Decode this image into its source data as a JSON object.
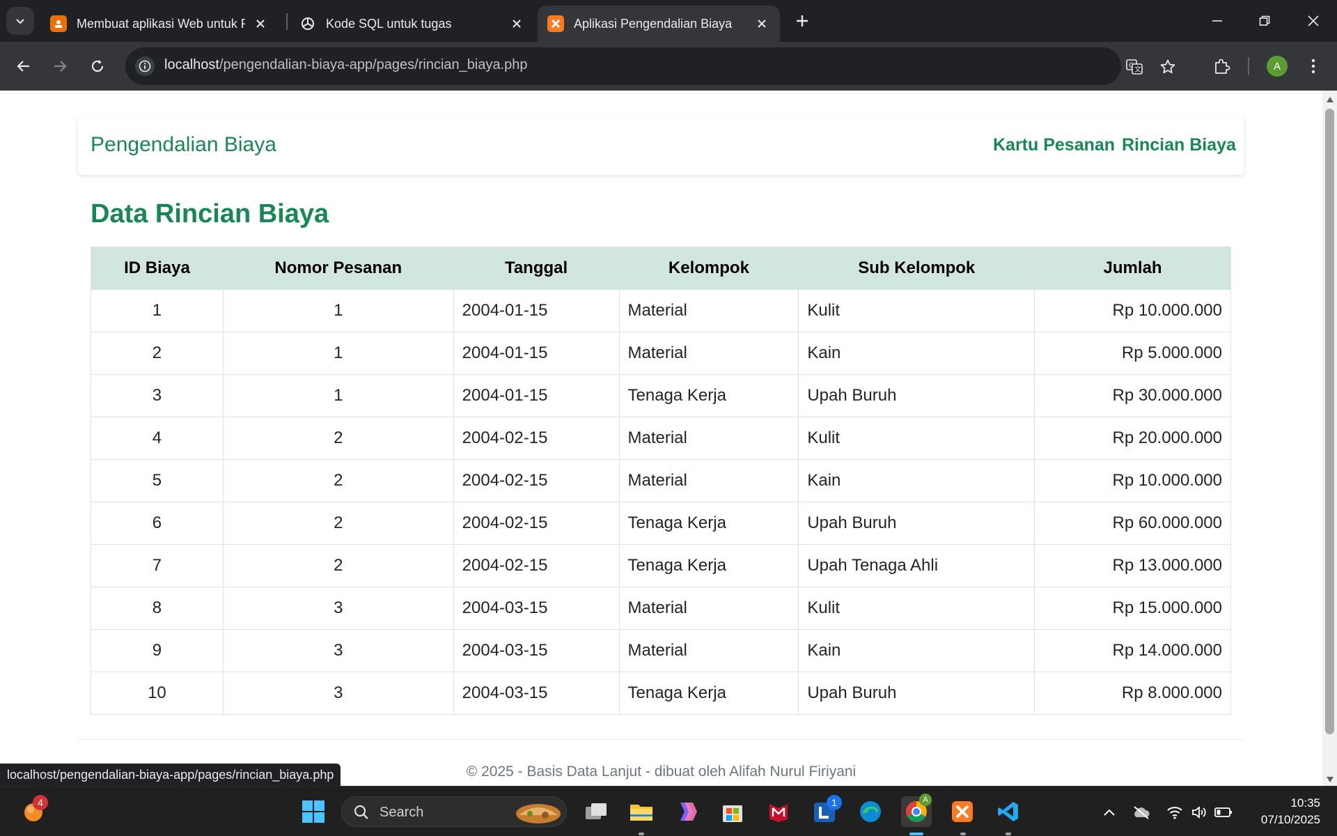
{
  "browser": {
    "tabs": [
      {
        "title": "Membuat aplikasi Web untuk P",
        "favicon": "presentation-app-icon",
        "active": false
      },
      {
        "title": "Kode SQL untuk tugas",
        "favicon": "chatgpt-icon",
        "active": false
      },
      {
        "title": "Aplikasi Pengendalian Biaya",
        "favicon": "xampp-icon",
        "active": true
      }
    ],
    "url_host": "localhost",
    "url_path": "/pengendalian-biaya-app/pages/rincian_biaya.php",
    "profile_initial": "A",
    "status_url": "localhost/pengendalian-biaya-app/pages/rincian_biaya.php"
  },
  "app": {
    "brand": "Pengendalian Biaya",
    "nav": [
      {
        "label": "Kartu Pesanan"
      },
      {
        "label": "Rincian Biaya"
      }
    ],
    "heading": "Data Rincian Biaya",
    "table": {
      "headers": [
        "ID Biaya",
        "Nomor Pesanan",
        "Tanggal",
        "Kelompok",
        "Sub Kelompok",
        "Jumlah"
      ],
      "rows": [
        [
          "1",
          "1",
          "2004-01-15",
          "Material",
          "Kulit",
          "Rp 10.000.000"
        ],
        [
          "2",
          "1",
          "2004-01-15",
          "Material",
          "Kain",
          "Rp 5.000.000"
        ],
        [
          "3",
          "1",
          "2004-01-15",
          "Tenaga Kerja",
          "Upah Buruh",
          "Rp 30.000.000"
        ],
        [
          "4",
          "2",
          "2004-02-15",
          "Material",
          "Kulit",
          "Rp 20.000.000"
        ],
        [
          "5",
          "2",
          "2004-02-15",
          "Material",
          "Kain",
          "Rp 10.000.000"
        ],
        [
          "6",
          "2",
          "2004-02-15",
          "Tenaga Kerja",
          "Upah Buruh",
          "Rp 60.000.000"
        ],
        [
          "7",
          "2",
          "2004-02-15",
          "Tenaga Kerja",
          "Upah Tenaga Ahli",
          "Rp 13.000.000"
        ],
        [
          "8",
          "3",
          "2004-03-15",
          "Material",
          "Kulit",
          "Rp 15.000.000"
        ],
        [
          "9",
          "3",
          "2004-03-15",
          "Material",
          "Kain",
          "Rp 14.000.000"
        ],
        [
          "10",
          "3",
          "2004-03-15",
          "Tenaga Kerja",
          "Upah Buruh",
          "Rp 8.000.000"
        ]
      ]
    },
    "footer": "© 2025 - Basis Data Lanjut - dibuat oleh Alifah Nurul Firiyani"
  },
  "taskbar": {
    "search_label": "Search",
    "notification_count": "4",
    "app_badge": "1",
    "time": "10:35",
    "date": "07/10/2025"
  },
  "colors": {
    "brand_green": "#198754",
    "table_header_bg": "#d1e7dd"
  }
}
